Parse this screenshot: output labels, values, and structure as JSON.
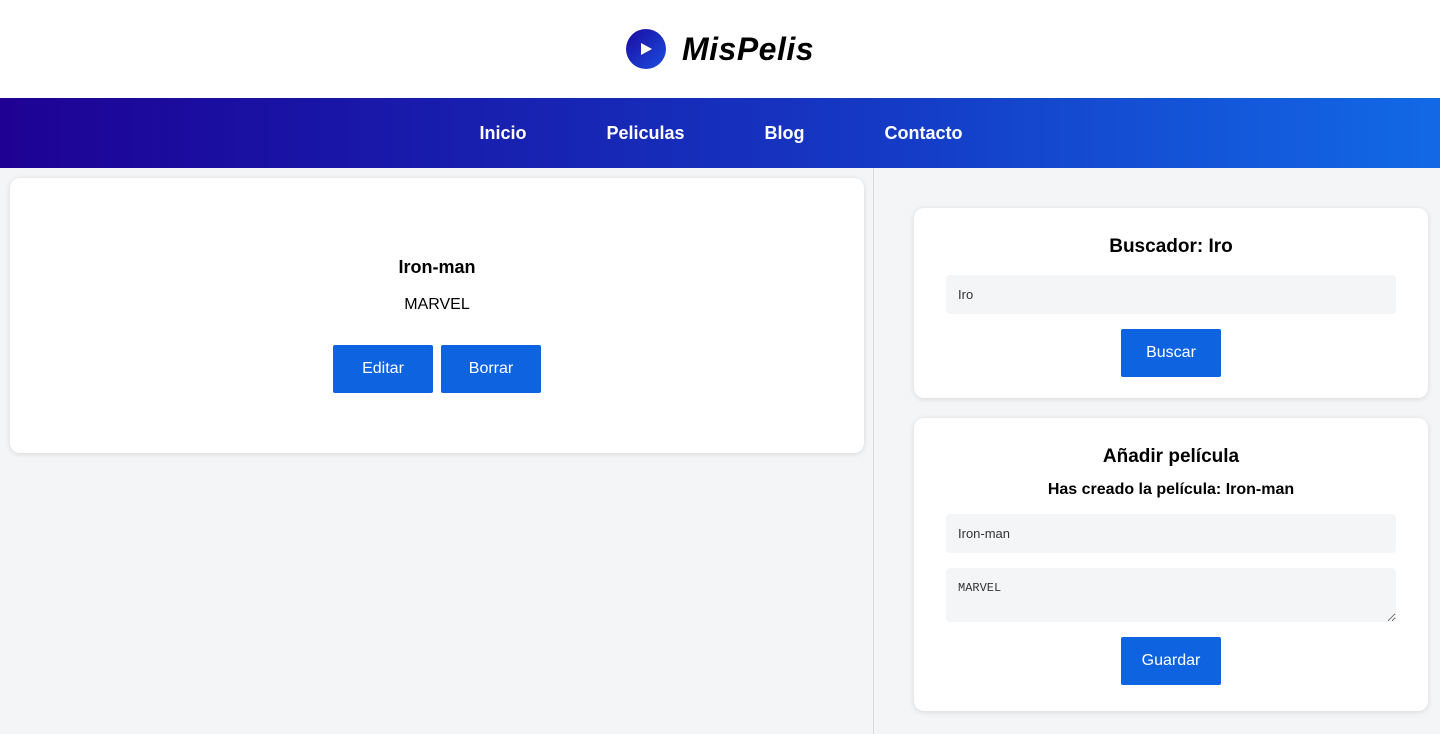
{
  "brand": {
    "name": "MisPelis",
    "icon": "play-icon"
  },
  "nav": {
    "items": [
      {
        "label": "Inicio"
      },
      {
        "label": "Peliculas"
      },
      {
        "label": "Blog"
      },
      {
        "label": "Contacto"
      }
    ]
  },
  "movie": {
    "title": "Iron-man",
    "description": "MARVEL",
    "edit_label": "Editar",
    "delete_label": "Borrar"
  },
  "search": {
    "title": "Buscador: Iro",
    "value": "Iro",
    "button_label": "Buscar"
  },
  "add": {
    "title": "Añadir película",
    "message": "Has creado la película: Iron-man",
    "title_value": "Iron-man",
    "description_value": "MARVEL",
    "button_label": "Guardar"
  },
  "colors": {
    "accent": "#0d63e0",
    "nav_start": "#1f0294",
    "nav_end": "#1269e6"
  }
}
